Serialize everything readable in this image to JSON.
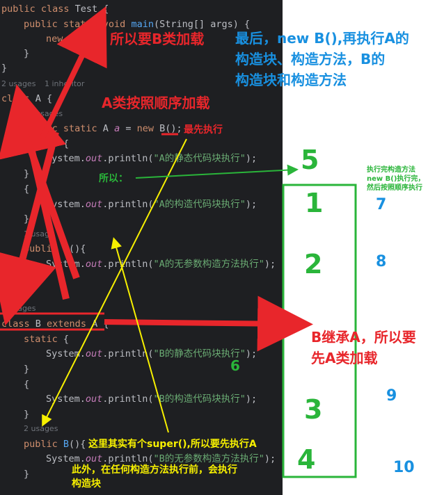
{
  "code": {
    "lines": [
      {
        "parts": [
          {
            "c": "kw",
            "t": "public class "
          },
          {
            "c": "pl",
            "t": "Test {"
          }
        ]
      },
      {
        "parts": [
          {
            "c": "kw",
            "t": "public static void "
          },
          {
            "c": "fn",
            "t": "main"
          },
          {
            "c": "pl",
            "t": "(String[] args) {"
          }
        ]
      },
      {
        "parts": [
          {
            "c": "kw",
            "t": "new "
          },
          {
            "c": "pl",
            "t": "B();"
          }
        ]
      },
      {
        "parts": [
          {
            "c": "pl",
            "t": "}"
          }
        ]
      },
      {
        "parts": [
          {
            "c": "pl",
            "t": "}"
          }
        ]
      },
      {
        "parts": [
          {
            "c": "kw",
            "t": "class "
          },
          {
            "c": "pl",
            "t": "A {"
          }
        ]
      },
      {
        "parts": [
          {
            "c": "kw",
            "t": "public static "
          },
          {
            "c": "pl",
            "t": "A "
          },
          {
            "c": "it",
            "t": "a"
          },
          {
            "c": "pl",
            "t": " = "
          },
          {
            "c": "kw",
            "t": "new "
          },
          {
            "c": "pl",
            "t": "B();"
          }
        ]
      },
      {
        "parts": [
          {
            "c": "kw",
            "t": "static "
          },
          {
            "c": "pl",
            "t": "{"
          }
        ]
      },
      {
        "parts": [
          {
            "c": "pl",
            "t": "System."
          },
          {
            "c": "it",
            "t": "out"
          },
          {
            "c": "pl",
            "t": ".println("
          },
          {
            "c": "st",
            "t": "\"A的静态代码块执行\""
          },
          {
            "c": "pl",
            "t": ");"
          }
        ]
      },
      {
        "parts": [
          {
            "c": "pl",
            "t": "}"
          }
        ]
      },
      {
        "parts": [
          {
            "c": "pl",
            "t": "{"
          }
        ]
      },
      {
        "parts": [
          {
            "c": "pl",
            "t": "System."
          },
          {
            "c": "it",
            "t": "out"
          },
          {
            "c": "pl",
            "t": ".println("
          },
          {
            "c": "st",
            "t": "\"A的构造代码块执行\""
          },
          {
            "c": "pl",
            "t": ");"
          }
        ]
      },
      {
        "parts": [
          {
            "c": "pl",
            "t": "}"
          }
        ]
      },
      {
        "parts": [
          {
            "c": "kw",
            "t": "public "
          },
          {
            "c": "fn",
            "t": "A"
          },
          {
            "c": "pl",
            "t": "(){"
          }
        ]
      },
      {
        "parts": [
          {
            "c": "pl",
            "t": "System."
          },
          {
            "c": "it",
            "t": "out"
          },
          {
            "c": "pl",
            "t": ".println("
          },
          {
            "c": "st",
            "t": "\"A的无参数构造方法执行\""
          },
          {
            "c": "pl",
            "t": ");"
          }
        ]
      },
      {
        "parts": [
          {
            "c": "pl",
            "t": "}"
          }
        ]
      },
      {
        "parts": [
          {
            "c": "pl",
            "t": "}"
          }
        ]
      },
      {
        "parts": [
          {
            "c": "kw",
            "t": "class "
          },
          {
            "c": "pl",
            "t": "B "
          },
          {
            "c": "kw",
            "t": "extends "
          },
          {
            "c": "pl",
            "t": "A {"
          }
        ]
      },
      {
        "parts": [
          {
            "c": "kw",
            "t": "static "
          },
          {
            "c": "pl",
            "t": "{"
          }
        ]
      },
      {
        "parts": [
          {
            "c": "pl",
            "t": "System."
          },
          {
            "c": "it",
            "t": "out"
          },
          {
            "c": "pl",
            "t": ".println("
          },
          {
            "c": "st",
            "t": "\"B的静态代码块执行\""
          },
          {
            "c": "pl",
            "t": ");"
          }
        ]
      },
      {
        "parts": [
          {
            "c": "pl",
            "t": "}"
          }
        ]
      },
      {
        "parts": [
          {
            "c": "pl",
            "t": "{"
          }
        ]
      },
      {
        "parts": [
          {
            "c": "pl",
            "t": "System."
          },
          {
            "c": "it",
            "t": "out"
          },
          {
            "c": "pl",
            "t": ".println("
          },
          {
            "c": "st",
            "t": "\"B的构造代码块执行\""
          },
          {
            "c": "pl",
            "t": ");"
          }
        ]
      },
      {
        "parts": [
          {
            "c": "pl",
            "t": "}"
          }
        ]
      },
      {
        "parts": [
          {
            "c": "kw",
            "t": "public "
          },
          {
            "c": "fn",
            "t": "B"
          },
          {
            "c": "pl",
            "t": "(){"
          }
        ]
      },
      {
        "parts": [
          {
            "c": "pl",
            "t": "System."
          },
          {
            "c": "it",
            "t": "out"
          },
          {
            "c": "pl",
            "t": ".println("
          },
          {
            "c": "st",
            "t": "\"B的无参数构造方法执行\""
          },
          {
            "c": "pl",
            "t": ");"
          }
        ]
      },
      {
        "parts": [
          {
            "c": "pl",
            "t": "}"
          }
        ]
      }
    ],
    "hints": {
      "usages_a": "2 usages",
      "inheritor": "1 inheritor",
      "no_usages": "no usages",
      "one_usage": "1 usage",
      "usages_b": "2 usages",
      "usages_ctor": "2 usages"
    }
  },
  "annotations": {
    "load_b": "所以要B类加载",
    "last": "最后，new B(),再执行A的\n构造块、构造方法，B的\n构造块和构造方法",
    "load_a_order": "A类按照顺序加载",
    "first_exec": "最先执行",
    "so": "所以：",
    "after_ctor": "执行完构造方法\nnew B()执行完，\n然后按照顺序执行",
    "b_extends_a": "B继承A，所以要\n先A类加载",
    "super_note": "这里其实有个super(),所以要先执行A",
    "before_ctor": "此外，在任何构造方法执行前，会执行\n构造块"
  },
  "order_numbers": {
    "n1": "1",
    "n2": "2",
    "n3": "3",
    "n4": "4",
    "n5": "5",
    "n6": "6",
    "n7": "7",
    "n8": "8",
    "n9": "9",
    "n10": "10"
  },
  "colors": {
    "editor_bg": "#1e1f22",
    "red": "#e8262b",
    "blue": "#1890e0",
    "green": "#2ab53a",
    "yellow": "#f7f000"
  }
}
